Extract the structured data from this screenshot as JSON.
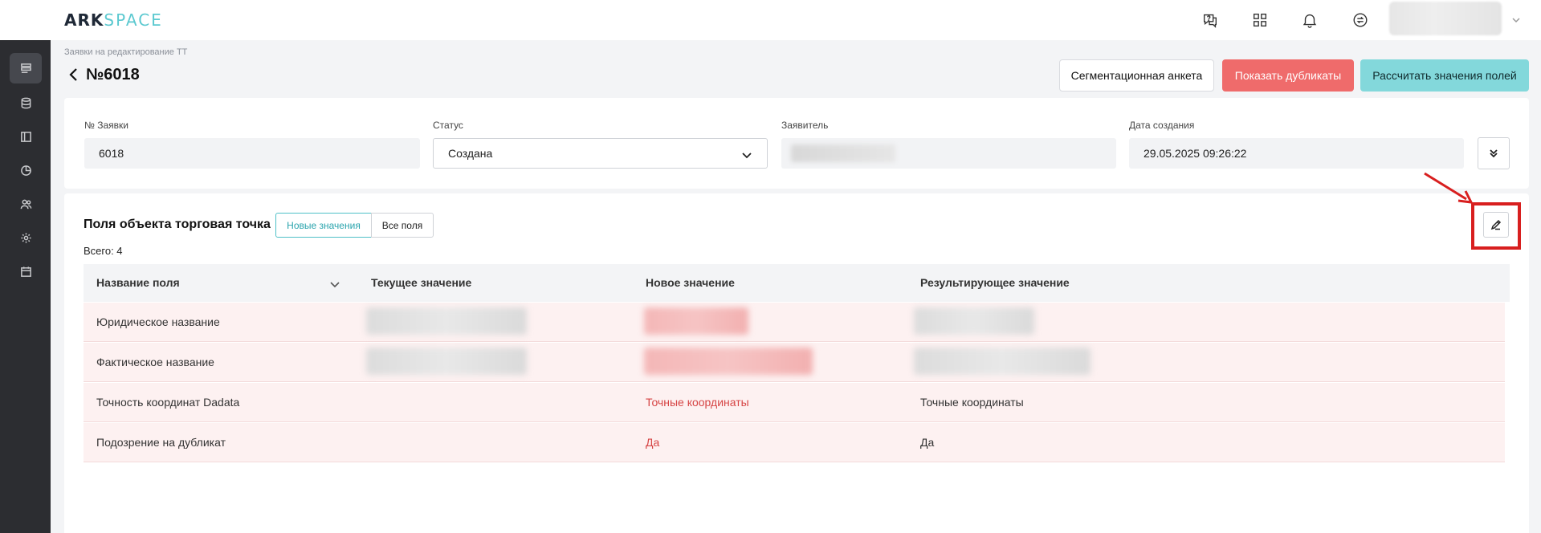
{
  "app": {
    "logo_primary": "ARK",
    "logo_secondary": "SPACE"
  },
  "header": {
    "icons": [
      "chat-help-icon",
      "apps-grid-icon",
      "bell-icon",
      "sync-icon"
    ]
  },
  "sidebar": {
    "items": [
      {
        "icon": "list-icon",
        "active": true
      },
      {
        "icon": "database-icon",
        "active": false
      },
      {
        "icon": "layout-icon",
        "active": false
      },
      {
        "icon": "pie-chart-icon",
        "active": false
      },
      {
        "icon": "users-icon",
        "active": false
      },
      {
        "icon": "gear-icon",
        "active": false
      },
      {
        "icon": "calendar-icon",
        "active": false
      }
    ]
  },
  "page": {
    "breadcrumb": "Заявки на редактирование ТТ",
    "title": "№6018",
    "buttons": {
      "segmentation": "Сегментационная анкета",
      "duplicates": "Показать дубликаты",
      "calculate": "Рассчитать значения полей"
    }
  },
  "details": {
    "request_number_label": "№ Заявки",
    "request_number_value": "6018",
    "status_label": "Статус",
    "status_value": "Создана",
    "applicant_label": "Заявитель",
    "created_label": "Дата создания",
    "created_value": "29.05.2025 09:26:22"
  },
  "fields_section": {
    "title": "Поля объекта торговая точка",
    "tab_new": "Новые значения",
    "tab_all": "Все поля",
    "total": "Всего: 4",
    "columns": [
      "Название поля",
      "Текущее значение",
      "Новое значение",
      "Результирующее значение"
    ],
    "rows": [
      {
        "name": "Юридическое название",
        "current": "",
        "new": "",
        "result": ""
      },
      {
        "name": "Фактическое название",
        "current": "",
        "new": "",
        "result": ""
      },
      {
        "name": "Точность координат Dadata",
        "current": "",
        "new": "Точные координаты",
        "result": "Точные координаты"
      },
      {
        "name": "Подозрение на дубликат",
        "current": "",
        "new": "Да",
        "result": "Да"
      }
    ]
  },
  "colors": {
    "accent": "#5cc9d0",
    "danger": "#ef6b6b",
    "highlight": "#d81f1f",
    "sidebar": "#2c2d31"
  }
}
